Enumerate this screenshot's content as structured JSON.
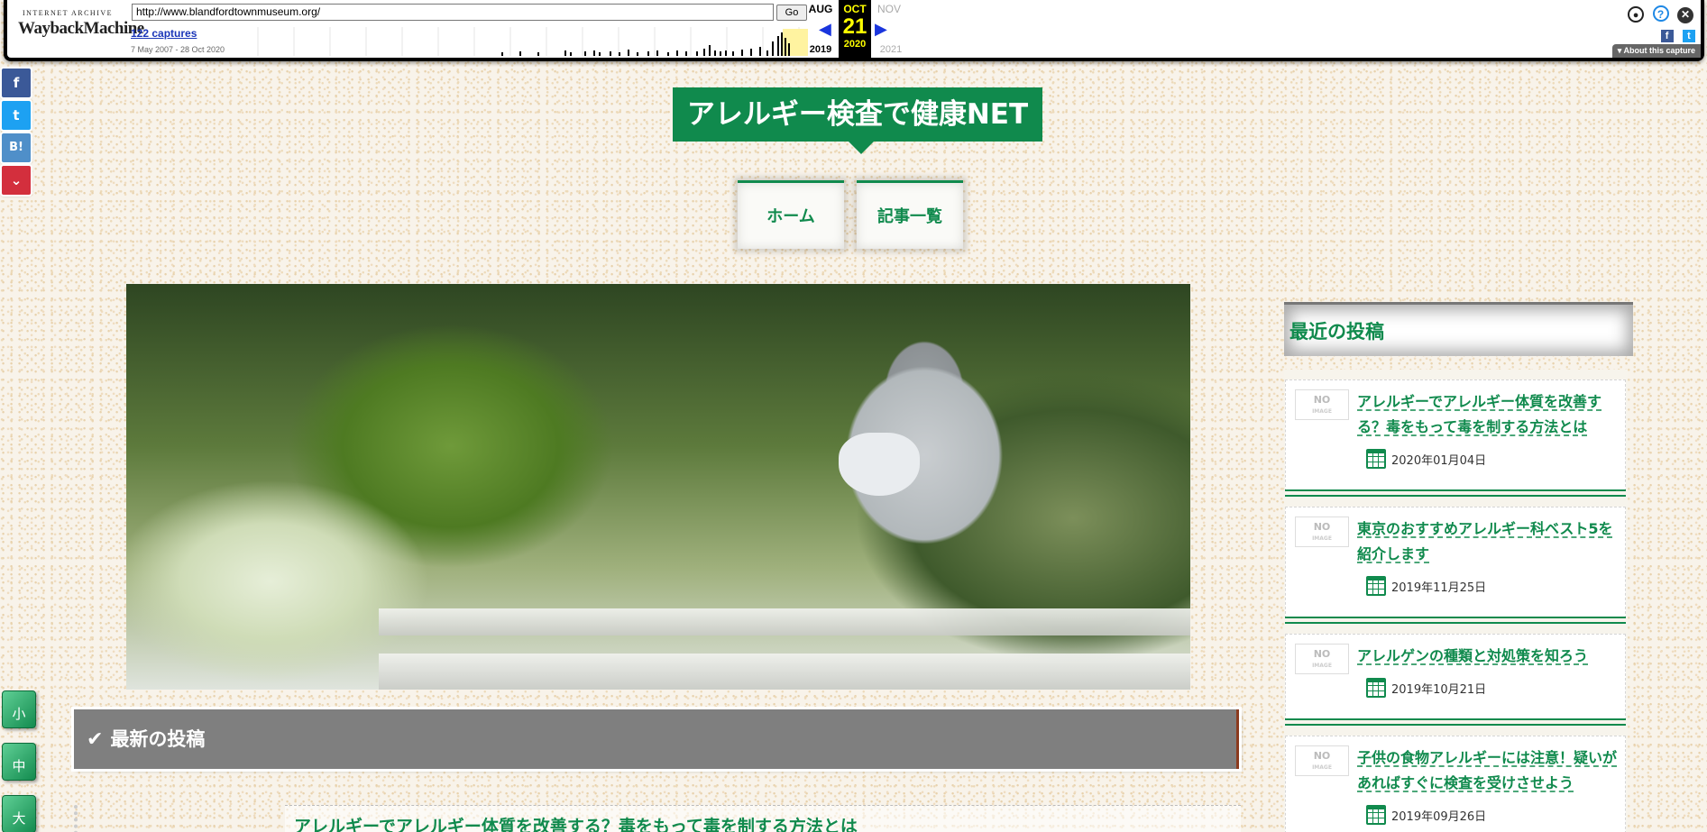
{
  "wayback": {
    "logo_top": "INTERNET ARCHIVE",
    "logo_main": "WaybackMachine",
    "url": "http://www.blandfordtownmuseum.org/",
    "go": "Go",
    "captures": "122 captures",
    "range": "7 May 2007 - 28 Oct 2020",
    "prev_month": "AUG",
    "prev_year": "2019",
    "cur_month": "OCT",
    "cur_day": "21",
    "cur_year": "2020",
    "next_month": "NOV",
    "next_year": "2021",
    "about": "About this capture"
  },
  "share": [
    "f",
    "t",
    "B!",
    "p"
  ],
  "font_size_buttons": [
    "小",
    "中",
    "大"
  ],
  "site": {
    "title": "アレルギー検査で健康NET",
    "nav": [
      "ホーム",
      "記事一覧"
    ]
  },
  "main": {
    "latest_heading": "最新の投稿",
    "first_post_title": "アレルギーでアレルギー体質を改善する？毒をもって毒を制する方法とは"
  },
  "sidebar": {
    "heading": "最近の投稿",
    "thumb_label": "NO",
    "thumb_sub": "IMAGE",
    "posts": [
      {
        "title": "アレルギーでアレルギー体質を改善する？毒をもって毒を制する方法とは",
        "date": "2020年01月04日"
      },
      {
        "title": "東京のおすすめアレルギー科ベスト5を紹介します",
        "date": "2019年11月25日"
      },
      {
        "title": "アレルゲンの種類と対処策を知ろう",
        "date": "2019年10月21日"
      },
      {
        "title": "子供の食物アレルギーには注意！疑いがあればすぐに検査を受けさせよう",
        "date": "2019年09月26日"
      }
    ]
  },
  "colors": {
    "brand_green": "#108a4d",
    "latest_bar": "#7f7f7f"
  }
}
